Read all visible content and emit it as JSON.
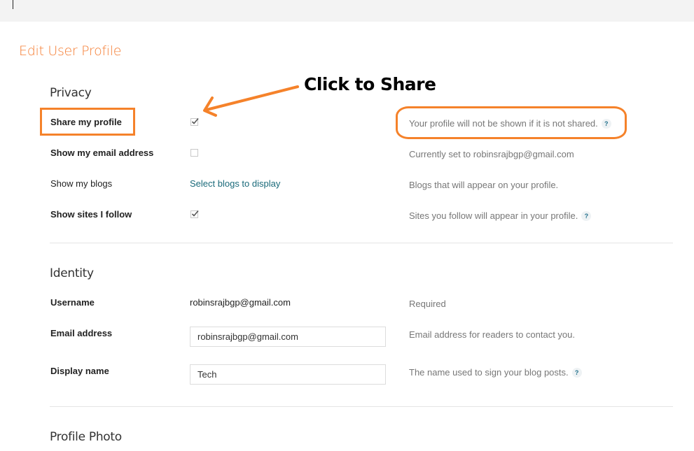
{
  "page": {
    "title": "Edit User Profile",
    "accent_color": "#f57d33"
  },
  "privacy": {
    "title": "Privacy",
    "rows": [
      {
        "label": "Share my profile",
        "control": "checkbox",
        "checked": true,
        "help": "Your profile will not be shown if it is not shared.",
        "help_icon": "?"
      },
      {
        "label": "Show my email address",
        "control": "checkbox",
        "checked": false,
        "help": "Currently set to robinsrajbgp@gmail.com"
      },
      {
        "label": "Show my blogs",
        "control": "link",
        "link_text": "Select blogs to display",
        "help": "Blogs that will appear on your profile."
      },
      {
        "label": "Show sites I follow",
        "control": "checkbox",
        "checked": true,
        "help": "Sites you follow will appear in your profile.",
        "help_icon": "?"
      }
    ]
  },
  "identity": {
    "title": "Identity",
    "username": {
      "label": "Username",
      "value": "robinsrajbgp@gmail.com",
      "help": "Required"
    },
    "email": {
      "label": "Email address",
      "value": "robinsrajbgp@gmail.com",
      "help": "Email address for readers to contact you."
    },
    "display_name": {
      "label": "Display name",
      "value": "Tech",
      "help": "The name used to sign your blog posts.",
      "help_icon": "?"
    }
  },
  "profile_photo": {
    "title": "Profile Photo"
  },
  "annotation": {
    "text": "Click to Share",
    "color": "#f5822a"
  }
}
